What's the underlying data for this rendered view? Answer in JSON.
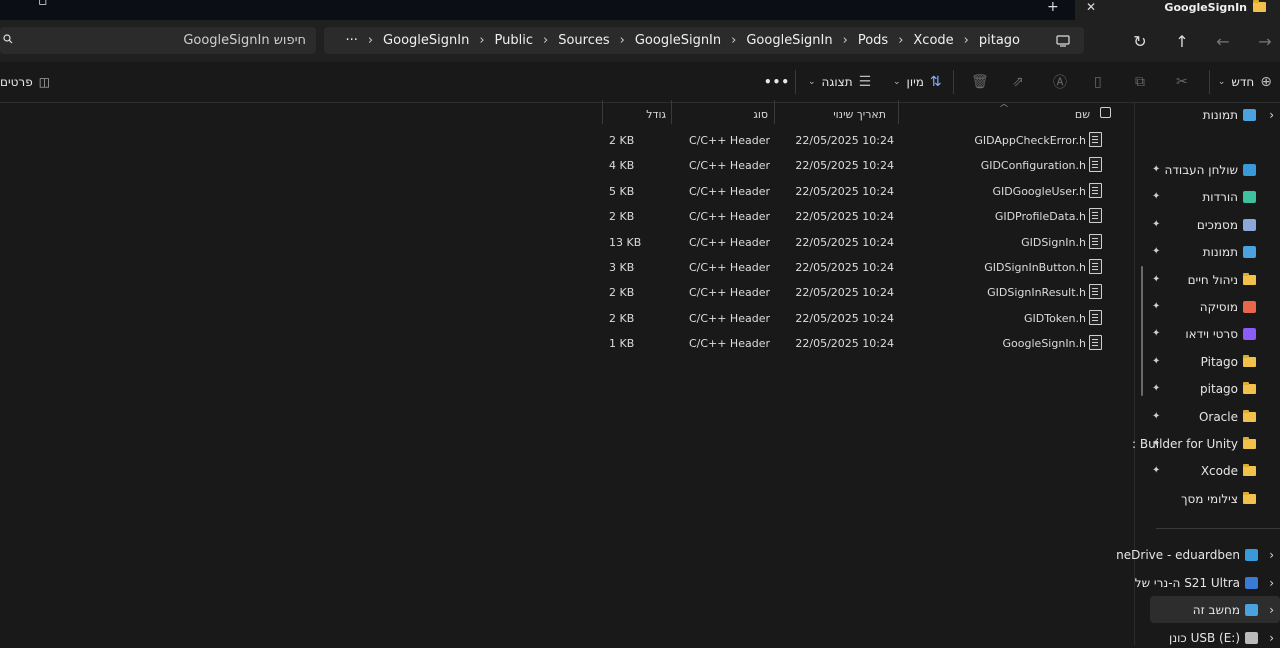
{
  "window": {
    "tab_title": "GoogleSignIn",
    "new_tab": "+",
    "close_tab": "✕"
  },
  "address": {
    "breadcrumbs": [
      "pitago",
      "Xcode",
      "Pods",
      "GoogleSignIn",
      "GoogleSignIn",
      "Sources",
      "Public",
      "GoogleSignIn"
    ],
    "overflow": "···"
  },
  "search": {
    "placeholder": "חיפוש GoogleSignIn"
  },
  "toolbar": {
    "new_label": "חדש",
    "sort_label": "מיון",
    "view_label": "תצוגה",
    "more_label": "•••",
    "details_label": "פרטים"
  },
  "columns": {
    "name": "שם",
    "date": "תאריך שינוי",
    "type": "סוג",
    "size": "גודל"
  },
  "files": [
    {
      "name": "GIDAppCheckError.h",
      "date": "22/05/2025 10:24",
      "type": "C/C++ Header",
      "size": "2 KB"
    },
    {
      "name": "GIDConfiguration.h",
      "date": "22/05/2025 10:24",
      "type": "C/C++ Header",
      "size": "4 KB"
    },
    {
      "name": "GIDGoogleUser.h",
      "date": "22/05/2025 10:24",
      "type": "C/C++ Header",
      "size": "5 KB"
    },
    {
      "name": "GIDProfileData.h",
      "date": "22/05/2025 10:24",
      "type": "C/C++ Header",
      "size": "2 KB"
    },
    {
      "name": "GIDSignIn.h",
      "date": "22/05/2025 10:24",
      "type": "C/C++ Header",
      "size": "13 KB"
    },
    {
      "name": "GIDSignInButton.h",
      "date": "22/05/2025 10:24",
      "type": "C/C++ Header",
      "size": "3 KB"
    },
    {
      "name": "GIDSignInResult.h",
      "date": "22/05/2025 10:24",
      "type": "C/C++ Header",
      "size": "2 KB"
    },
    {
      "name": "GIDToken.h",
      "date": "22/05/2025 10:24",
      "type": "C/C++ Header",
      "size": "2 KB"
    },
    {
      "name": "GoogleSignIn.h",
      "date": "22/05/2025 10:24",
      "type": "C/C++ Header",
      "size": "1 KB"
    }
  ],
  "sidebar": {
    "top_item": "תמונות",
    "quick_access": [
      {
        "label": "שולחן העבודה",
        "icon": "desktop-icon",
        "color": "#3a9ad9"
      },
      {
        "label": "הורדות",
        "icon": "download-icon",
        "color": "#3fc1a0"
      },
      {
        "label": "מסמכים",
        "icon": "documents-icon",
        "color": "#8aa8d8"
      },
      {
        "label": "תמונות",
        "icon": "pictures-icon",
        "color": "#4aa3df"
      },
      {
        "label": "ניהול חיים",
        "icon": "folder-icon",
        "color": "#f2c14b"
      },
      {
        "label": "מוסיקה",
        "icon": "music-icon",
        "color": "#e8674a"
      },
      {
        "label": "סרטי וידאו",
        "icon": "videos-icon",
        "color": "#8b5cf6"
      },
      {
        "label": "Pitago",
        "icon": "folder-icon",
        "color": "#f2c14b"
      },
      {
        "label": "pitago",
        "icon": "folder-icon",
        "color": "#f2c14b"
      },
      {
        "label": "Oracle",
        "icon": "folder-icon",
        "color": "#f2c14b"
      },
      {
        "label": "Builder for Unity :",
        "icon": "folder-icon",
        "color": "#f2c14b"
      },
      {
        "label": "Xcode",
        "icon": "folder-icon",
        "color": "#f2c14b"
      },
      {
        "label": "צילומי מסך",
        "icon": "folder-icon",
        "color": "#f2c14b"
      }
    ],
    "locations": [
      {
        "label": "neDrive - eduardben",
        "icon": "onedrive-icon",
        "color": "#3a9ad9"
      },
      {
        "label": "S21 Ultra ה-נרי של",
        "icon": "phone-icon",
        "color": "#3a7bd5"
      },
      {
        "label": "מחשב זה",
        "icon": "computer-icon",
        "color": "#4aa3df"
      },
      {
        "label": "USB (E:) כונן",
        "icon": "usb-drive-icon",
        "color": "#bbbbbb"
      }
    ]
  }
}
